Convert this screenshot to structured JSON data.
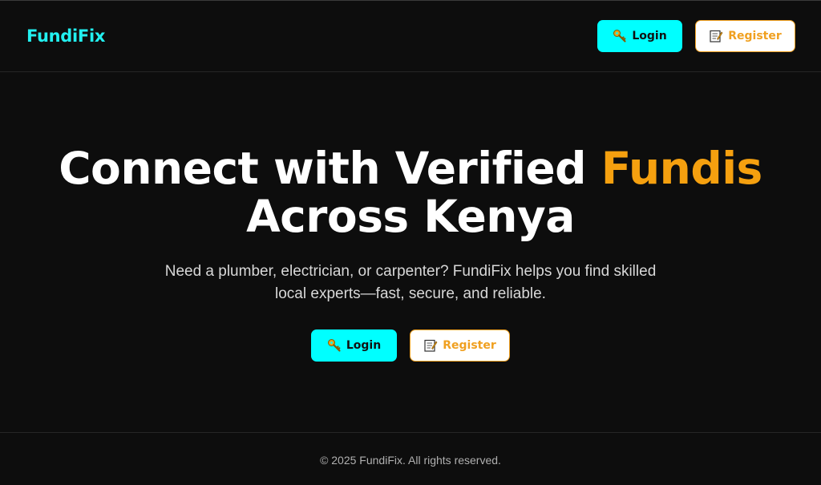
{
  "header": {
    "brand": "FundiFix",
    "login_label": "Login",
    "register_label": "Register"
  },
  "hero": {
    "title_part1": "Connect with Verified ",
    "title_accent": "Fundis",
    "title_part2": "Across Kenya",
    "subtitle_line1": "Need a plumber, electrician, or carpenter? FundiFix helps you find skilled",
    "subtitle_line2": "local experts—fast, secure, and reliable.",
    "login_label": "Login",
    "register_label": "Register"
  },
  "footer": {
    "copyright": "© 2025 FundiFix. All rights reserved."
  },
  "icons": {
    "login": "key-icon",
    "register": "memo-icon"
  },
  "colors": {
    "brand": "#22f0f0",
    "accent": "#f5a00f",
    "login_button": "#00ffff",
    "background": "#0d0d0d"
  }
}
